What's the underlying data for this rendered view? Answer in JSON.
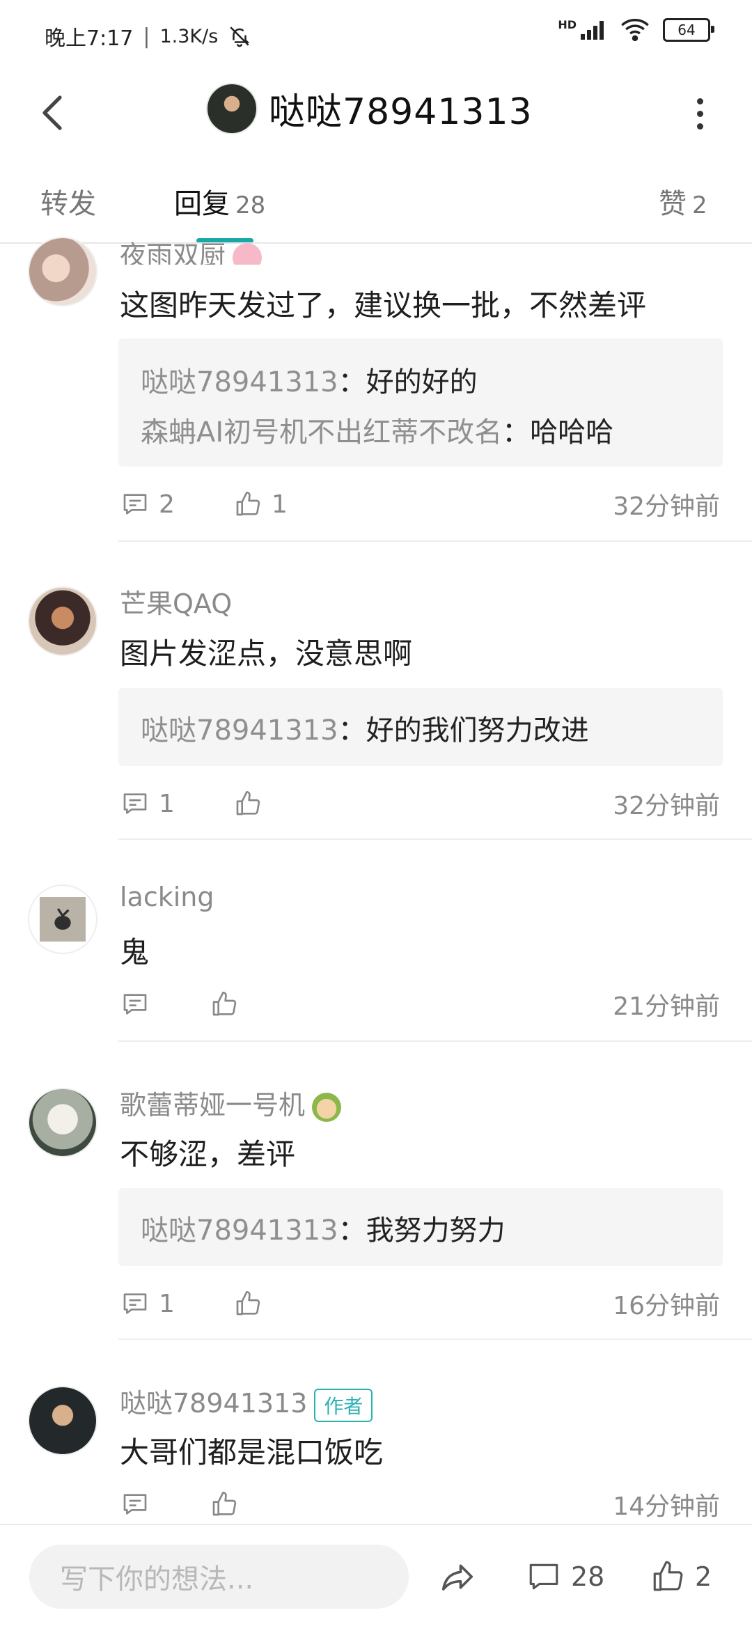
{
  "status_bar": {
    "time": "晚上7:17",
    "separator": "|",
    "speed": "1.3K/s",
    "network": "HD",
    "battery": "64"
  },
  "header": {
    "title": "哒哒78941313"
  },
  "tabs": [
    {
      "label": "转发",
      "count": ""
    },
    {
      "label": "回复",
      "count": "28"
    },
    {
      "label": "赞",
      "count": "2"
    }
  ],
  "comments": [
    {
      "user": "夜雨双厨",
      "text": "这图昨天发过了，建议换一批，不然差评",
      "replies": [
        {
          "name": "哒哒78941313",
          "text": "：好的好的"
        },
        {
          "name": "森蚺AI初号机不出红蒂不改名",
          "text": "：哈哈哈"
        }
      ],
      "comment_count": "2",
      "like_count": "1",
      "time": "32分钟前"
    },
    {
      "user": "芒果QAQ",
      "text": "图片发涩点，没意思啊",
      "replies": [
        {
          "name": "哒哒78941313",
          "text": "：好的我们努力改进"
        }
      ],
      "comment_count": "1",
      "like_count": "",
      "time": "32分钟前"
    },
    {
      "user": "lacking",
      "text": "鬼",
      "replies": [],
      "comment_count": "",
      "like_count": "",
      "time": "21分钟前"
    },
    {
      "user": "歌蕾蒂娅一号机",
      "text": "不够涩，差评",
      "replies": [
        {
          "name": "哒哒78941313",
          "text": "：我努力努力"
        }
      ],
      "comment_count": "1",
      "like_count": "",
      "time": "16分钟前"
    },
    {
      "user": "哒哒78941313",
      "badge": "作者",
      "text": "大哥们都是混口饭吃",
      "replies": [],
      "comment_count": "",
      "like_count": "",
      "time": "14分钟前"
    }
  ],
  "bottom_bar": {
    "placeholder": "写下你的想法...",
    "comment_count": "28",
    "like_count": "2"
  },
  "colors": {
    "accent": "#1aa7a8",
    "badge": "#2bb2b5",
    "reply_bg": "#f5f5f5"
  }
}
